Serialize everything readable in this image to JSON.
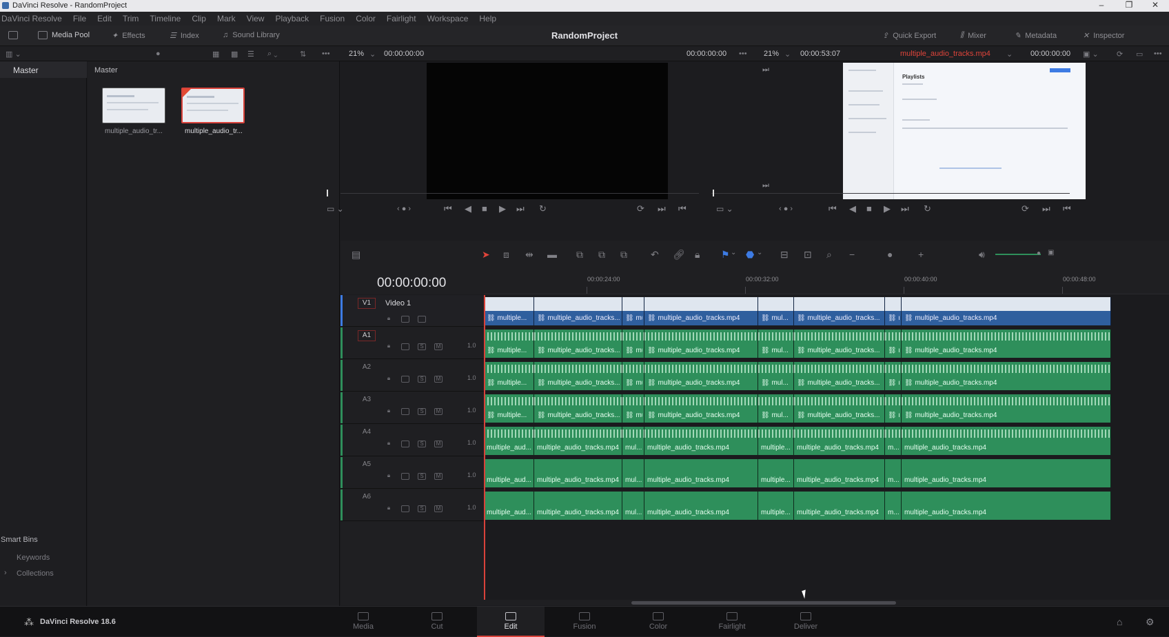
{
  "window": {
    "title": "DaVinci Resolve - RandomProject",
    "controls": [
      "–",
      "❐",
      "✕"
    ]
  },
  "menu": [
    "DaVinci Resolve",
    "File",
    "Edit",
    "Trim",
    "Timeline",
    "Clip",
    "Mark",
    "View",
    "Playback",
    "Fusion",
    "Color",
    "Fairlight",
    "Workspace",
    "Help"
  ],
  "toolbar": {
    "media_pool": "Media Pool",
    "effects": "Effects",
    "index": "Index",
    "sound_library": "Sound Library",
    "project_name": "RandomProject",
    "quick_export": "Quick Export",
    "mixer": "Mixer",
    "metadata": "Metadata",
    "inspector": "Inspector"
  },
  "subbar": {
    "src_zoom": "21%",
    "src_tc": "00:00:00:00",
    "src_tc2": "00:00:00:00",
    "tl_zoom": "21%",
    "tl_duration": "00:00:53:07",
    "tl_clip": "multiple_audio_tracks.mp4",
    "tl_tc": "00:00:00:00"
  },
  "bins": {
    "master": "Master",
    "smart_bins": "Smart Bins",
    "keywords": "Keywords",
    "collections": "Collections"
  },
  "media": {
    "header": "Master",
    "clips": [
      {
        "label": "multiple_audio_tr..."
      },
      {
        "label": "multiple_audio_tr..."
      }
    ]
  },
  "viewer": {
    "playlists": "Playlists"
  },
  "timeline": {
    "timecode": "00:00:00:00",
    "ruler": [
      "00:00:24:00",
      "00:00:32:00",
      "00:00:40:00",
      "00:00:48:00"
    ],
    "tracks": [
      {
        "id": "V1",
        "name": "Video 1",
        "type": "video"
      },
      {
        "id": "A1",
        "vol": "1.0",
        "type": "audio"
      },
      {
        "id": "A2",
        "vol": "1.0",
        "type": "audio"
      },
      {
        "id": "A3",
        "vol": "1.0",
        "type": "audio"
      },
      {
        "id": "A4",
        "vol": "1.0",
        "type": "audio"
      },
      {
        "id": "A5",
        "vol": "1.0",
        "type": "audio"
      },
      {
        "id": "A6",
        "vol": "1.0",
        "type": "audio"
      }
    ],
    "clips_linked": [
      "multiple...",
      "multiple_audio_tracks...",
      "mul...",
      "multiple_audio_tracks.mp4",
      "mul...",
      "multiple_audio_tracks...",
      "m...",
      "multiple_audio_tracks.mp4"
    ],
    "clips_plain": [
      "multiple_aud...",
      "multiple_audio_tracks.mp4",
      "mul...",
      "multiple_audio_tracks.mp4",
      "multiple...",
      "multiple_audio_tracks.mp4",
      "m...",
      "multiple_audio_tracks.mp4"
    ],
    "colors": {
      "video": "#2f5f9e",
      "audio": "#2e8f5b",
      "accent": "#d9423a"
    }
  },
  "footer": {
    "app_version": "DaVinci Resolve 18.6",
    "pages": [
      "Media",
      "Cut",
      "Edit",
      "Fusion",
      "Color",
      "Fairlight",
      "Deliver"
    ],
    "active_page": "Edit"
  }
}
